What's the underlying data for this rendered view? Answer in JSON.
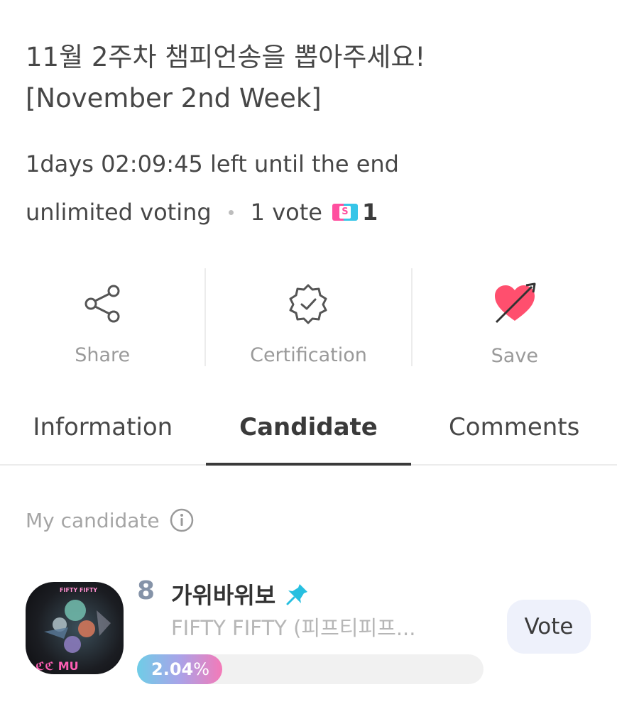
{
  "header": {
    "title_line1": "11월 2주차 챔피언송을 뽑아주세요!",
    "title_line2": "[November 2nd Week]",
    "time_left": "1days 02:09:45 left until the end",
    "voting_type": "unlimited voting",
    "vote_cost_label": "1 vote",
    "ticket_glyph": "S",
    "vote_cost_value": "1"
  },
  "actions": [
    {
      "label": "Share",
      "icon": "share-icon"
    },
    {
      "label": "Certification",
      "icon": "certification-badge-icon"
    },
    {
      "label": "Save",
      "icon": "heart-arrow-icon"
    }
  ],
  "tabs": [
    {
      "label": "Information",
      "active": false
    },
    {
      "label": "Candidate",
      "active": true
    },
    {
      "label": "Comments",
      "active": false
    }
  ],
  "my_candidate": {
    "label": "My candidate",
    "info_icon": "info-icon"
  },
  "candidate": {
    "rank": "8",
    "song": "가위바위보",
    "artist": "FIFTY FIFTY (피프티피프...",
    "percent": 2.04,
    "percent_label": "2.04",
    "percent_unit": "%",
    "vote_button": "Vote",
    "pin_icon": "pin-icon"
  },
  "colors": {
    "accent_pink": "#ff4f6e",
    "ticket_pink": "#ff4f9f",
    "ticket_cyan": "#36c5e8",
    "pin_cyan": "#27bfe0",
    "rank_gray_blue": "#8593a8",
    "vote_button_bg": "#eef1fb"
  }
}
